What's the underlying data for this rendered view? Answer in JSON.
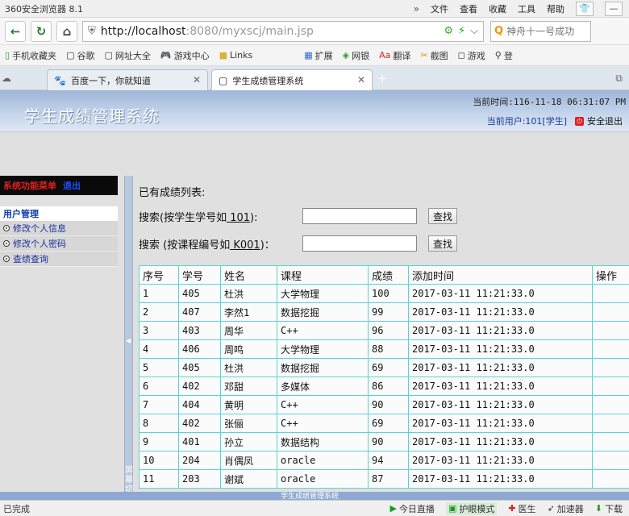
{
  "browser": {
    "app_title": "360安全浏览器 8.1",
    "menu": [
      "文件",
      "查看",
      "收藏",
      "工具",
      "帮助"
    ],
    "url_host": "http://localhost",
    "url_rest": ":8080/myxscj/main.jsp",
    "search_placeholder": "神舟十一号成功",
    "bookmarks": [
      "手机收藏夹",
      "谷歌",
      "网址大全",
      "游戏中心",
      "Links",
      "扩展",
      "网银",
      "翻译",
      "截图",
      "游戏",
      "登"
    ],
    "tabs": [
      {
        "label": "百度一下，你就知道",
        "icon": "paw-icon"
      },
      {
        "label": "学生成绩管理系统",
        "icon": "page-icon"
      }
    ]
  },
  "header": {
    "title": "学生成绩管理系统",
    "now_label": "当前时间:116-11-18 06:31:07 PM",
    "current_user": "当前用户:101[学生]",
    "logout": "安全退出"
  },
  "sidemenu": {
    "heading": "系统功能菜单",
    "exit": "退出",
    "group": "用户管理",
    "items": [
      "修改个人信息",
      "修改个人密码",
      "查绩查询"
    ]
  },
  "splitter_text": "屏幕切换",
  "main": {
    "list_title": "已有成绩列表:",
    "search_student": {
      "label_pre": "搜索(按学生学号如",
      "label_ex": " 101",
      "label_post": "):",
      "button": "查找",
      "value": ""
    },
    "search_course": {
      "label_pre": "搜索 (按课程编号如",
      "label_ex": " K001",
      "label_post": ")：",
      "button": "查找",
      "value": ""
    },
    "columns": [
      "序号",
      "学号",
      "姓名",
      "课程",
      "成绩",
      "添加时间",
      "操作"
    ],
    "rows": [
      [
        "1",
        "405",
        "杜洪",
        "大学物理",
        "100",
        "2017-03-11 11:21:33.0",
        ""
      ],
      [
        "2",
        "407",
        "李然1",
        "数据挖掘",
        "99",
        "2017-03-11 11:21:33.0",
        ""
      ],
      [
        "3",
        "403",
        "周华",
        "C++",
        "96",
        "2017-03-11 11:21:33.0",
        ""
      ],
      [
        "4",
        "406",
        "周鸣",
        "大学物理",
        "88",
        "2017-03-11 11:21:33.0",
        ""
      ],
      [
        "5",
        "405",
        "杜洪",
        "数据挖掘",
        "69",
        "2017-03-11 11:21:33.0",
        ""
      ],
      [
        "6",
        "402",
        "邓甜",
        "多媒体",
        "86",
        "2017-03-11 11:21:33.0",
        ""
      ],
      [
        "7",
        "404",
        "黄明",
        "C++",
        "90",
        "2017-03-11 11:21:33.0",
        ""
      ],
      [
        "8",
        "402",
        "张俪",
        "C++",
        "69",
        "2017-03-11 11:21:33.0",
        ""
      ],
      [
        "9",
        "401",
        "孙立",
        "数据结构",
        "90",
        "2017-03-11 11:21:33.0",
        ""
      ],
      [
        "10",
        "204",
        "肖偶凤",
        "oracle",
        "94",
        "2017-03-11 11:21:33.0",
        ""
      ],
      [
        "11",
        "203",
        "谢斌",
        "oracle",
        "87",
        "2017-03-11 11:21:33.0",
        ""
      ]
    ]
  },
  "footer": {
    "text": "学生成绩管理系统"
  },
  "statusbar": {
    "left": "已完成",
    "items": [
      "今日直播",
      "护眼模式",
      "医生",
      "加速器",
      "下载"
    ]
  }
}
